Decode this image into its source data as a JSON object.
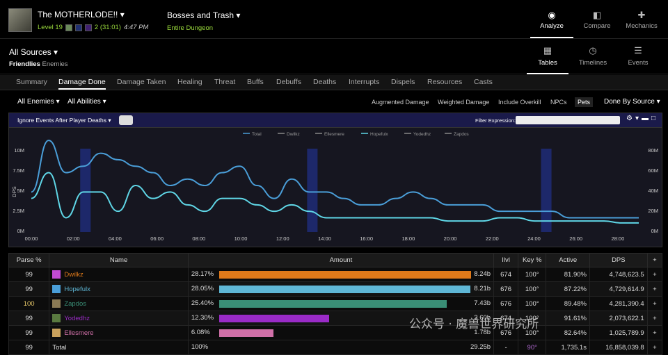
{
  "header": {
    "character": "The MOTHERLODE!!",
    "level": "Level 19",
    "kills": "2 (31:01)",
    "time": "4:47 PM",
    "fight": "Bosses and Trash",
    "dungeon": "Entire Dungeon",
    "nav": [
      {
        "label": "Analyze",
        "icon": "eye-icon"
      },
      {
        "label": "Compare",
        "icon": "compare-icon"
      },
      {
        "label": "Mechanics",
        "icon": "puzzle-icon"
      }
    ]
  },
  "sources": {
    "title": "All Sources",
    "friendlies": "Friendlies",
    "enemies": "Enemies"
  },
  "views": [
    {
      "label": "Tables",
      "icon": "grid-icon"
    },
    {
      "label": "Timelines",
      "icon": "clock-icon"
    },
    {
      "label": "Events",
      "icon": "list-icon"
    }
  ],
  "tabs": [
    "Summary",
    "Damage Done",
    "Damage Taken",
    "Healing",
    "Threat",
    "Buffs",
    "Debuffs",
    "Deaths",
    "Interrupts",
    "Dispels",
    "Resources",
    "Casts"
  ],
  "filters": {
    "enemies": "All Enemies",
    "abilities": "All Abilities",
    "options": [
      "Augmented Damage",
      "Weighted Damage",
      "Include Overkill",
      "NPCs",
      "Pets"
    ],
    "by_source": "Done By Source"
  },
  "chart_header": {
    "ignore": "Ignore Events After Player Deaths",
    "filter_label": "Filter Expression:"
  },
  "chart_data": {
    "type": "line",
    "ylabel": "DPS",
    "y_ticks": [
      "0M",
      "2.5M",
      "5M",
      "7.5M",
      "10M"
    ],
    "y2_ticks": [
      "0M",
      "20M",
      "40M",
      "60M",
      "80M"
    ],
    "x_ticks": [
      "00:00",
      "02:00",
      "04:00",
      "06:00",
      "08:00",
      "10:00",
      "12:00",
      "14:00",
      "16:00",
      "18:00",
      "20:00",
      "22:00",
      "24:00",
      "26:00",
      "28:00"
    ],
    "series": [
      {
        "name": "Total",
        "color": "#4a9ed8",
        "values": [
          6,
          14,
          9,
          10,
          12,
          11,
          10,
          9,
          7,
          8,
          7,
          9,
          10,
          7,
          5,
          8,
          6,
          6,
          5,
          4,
          4,
          5,
          6,
          5,
          4,
          4,
          4,
          3,
          3,
          3,
          3,
          2,
          2,
          2,
          2,
          2
        ]
      },
      {
        "name": "Dwilkz",
        "color": "#888888"
      },
      {
        "name": "Ellesmere",
        "color": "#888888"
      },
      {
        "name": "Hopefulx",
        "color": "#5fd6e6",
        "values": [
          5,
          9,
          2,
          6,
          6,
          3,
          7,
          5,
          6,
          4,
          3,
          5,
          5,
          4,
          3,
          4,
          3,
          2,
          2,
          2,
          2,
          2,
          2,
          2,
          1.5,
          1.5,
          1.5,
          2,
          2,
          1.5,
          1.5,
          1.5,
          1.5,
          1.5,
          1.2,
          1.2
        ]
      },
      {
        "name": "Yodedhz",
        "color": "#888888"
      },
      {
        "name": "Zapdos",
        "color": "#888888"
      }
    ],
    "highlight_bands": [
      "02:20-02:50",
      "13:10-13:40",
      "24:20-24:50"
    ]
  },
  "table": {
    "headers": [
      "Parse %",
      "Name",
      "Amount",
      "Ilvl",
      "Key %",
      "Active",
      "DPS",
      "+"
    ],
    "rows": [
      {
        "parse": "99",
        "name": "Dwilkz",
        "spec_color": "#c34bd4",
        "pct": "28.17%",
        "bar": 1.0,
        "bar_color": "#e07a1a",
        "amount": "8.24b",
        "ilvl": "674",
        "key": "100°",
        "active": "81.90%",
        "dps": "4,748,623.5",
        "gold": false
      },
      {
        "parse": "99",
        "name": "Hopefulx",
        "spec_color": "#4a9ed8",
        "pct": "28.05%",
        "bar": 0.996,
        "bar_color": "#5fb7d6",
        "amount": "8.21b",
        "ilvl": "676",
        "key": "100°",
        "active": "87.22%",
        "dps": "4,729,614.9",
        "gold": false
      },
      {
        "parse": "100",
        "name": "Zapdos",
        "spec_color": "#8a7a55",
        "pct": "25.40%",
        "bar": 0.902,
        "bar_color": "#3a8e76",
        "amount": "7.43b",
        "ilvl": "676",
        "key": "100°",
        "active": "89.48%",
        "dps": "4,281,390.4",
        "gold": true
      },
      {
        "parse": "99",
        "name": "Yodedhz",
        "spec_color": "#5a7a40",
        "pct": "12.30%",
        "bar": 0.437,
        "bar_color": "#9a2bc7",
        "amount": "3.60b",
        "ilvl": "674",
        "key": "100°",
        "active": "91.61%",
        "dps": "2,073,622.1",
        "gold": false
      },
      {
        "parse": "99",
        "name": "Ellesmere",
        "spec_color": "#c9a15c",
        "pct": "6.08%",
        "bar": 0.216,
        "bar_color": "#d070a8",
        "amount": "1.78b",
        "ilvl": "676",
        "key": "100°",
        "active": "82.64%",
        "dps": "1,025,789.9",
        "gold": false
      }
    ],
    "total": {
      "parse": "99",
      "name": "Total",
      "pct": "100%",
      "amount": "29.25b",
      "ilvl": "-",
      "key": "90°",
      "active": "1,735.1s",
      "dps": "16,858,039.8"
    }
  },
  "watermark": "公众号 · 魔兽世界研究所"
}
